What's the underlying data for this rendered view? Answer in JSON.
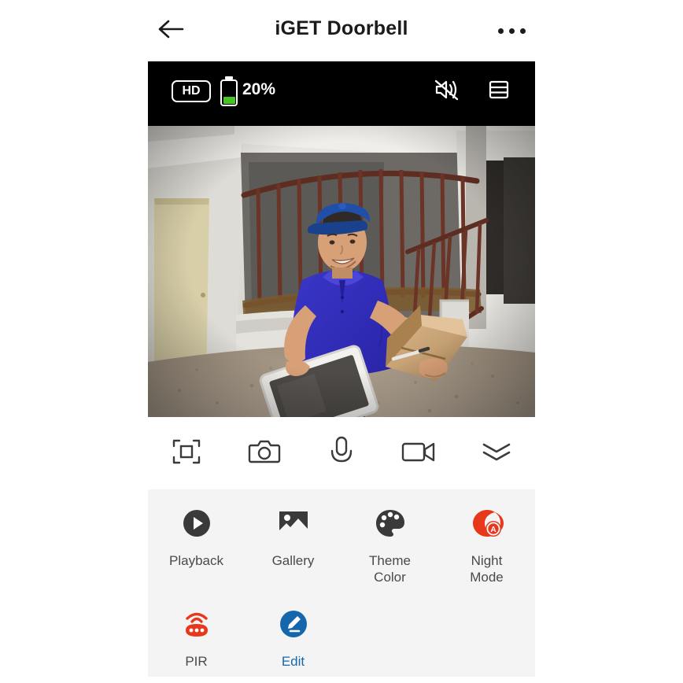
{
  "header": {
    "back_icon": "arrow-left-icon",
    "title": "iGET Doorbell",
    "more_icon": "more-horizontal-icon"
  },
  "video": {
    "quality_badge": "HD",
    "battery_level": "20%",
    "battery_icon": "battery-icon",
    "mute_icon": "speaker-muted-icon",
    "layout_icon": "split-view-icon",
    "scene_description": "Fisheye doorbell view of a stairwell with a delivery man in a blue cap and blue polo shirt holding a cardboard parcel and a white tablet"
  },
  "toolbar": {
    "items": [
      {
        "name": "fullscreen-button",
        "icon": "fullscreen-icon"
      },
      {
        "name": "snapshot-button",
        "icon": "camera-icon"
      },
      {
        "name": "talk-button",
        "icon": "microphone-icon"
      },
      {
        "name": "record-button",
        "icon": "video-camera-icon"
      },
      {
        "name": "expand-button",
        "icon": "double-chevron-down-icon"
      }
    ]
  },
  "features": {
    "row1": [
      {
        "label": "Playback",
        "icon": "play-circle-icon",
        "accent": false
      },
      {
        "label": "Gallery",
        "icon": "image-icon",
        "accent": false
      },
      {
        "label": "Theme\nColor",
        "label_line1": "Theme",
        "label_line2": "Color",
        "icon": "palette-icon",
        "accent": false
      },
      {
        "label": "Night\nMode",
        "label_line1": "Night",
        "label_line2": "Mode",
        "icon": "night-mode-icon",
        "accent": false
      }
    ],
    "row2": [
      {
        "label": "PIR",
        "icon": "pir-sensor-icon",
        "accent": false
      },
      {
        "label": "Edit",
        "icon": "edit-pencil-icon",
        "accent": true
      }
    ]
  },
  "colors": {
    "accent_blue": "#1566ad",
    "alert_red": "#e8381c",
    "battery_green": "#46c425",
    "panel_bg": "#f4f4f4",
    "icon_dark": "#3a3a3a",
    "text_dark": "#1b1b1b",
    "label_gray": "#4a4a4a"
  }
}
